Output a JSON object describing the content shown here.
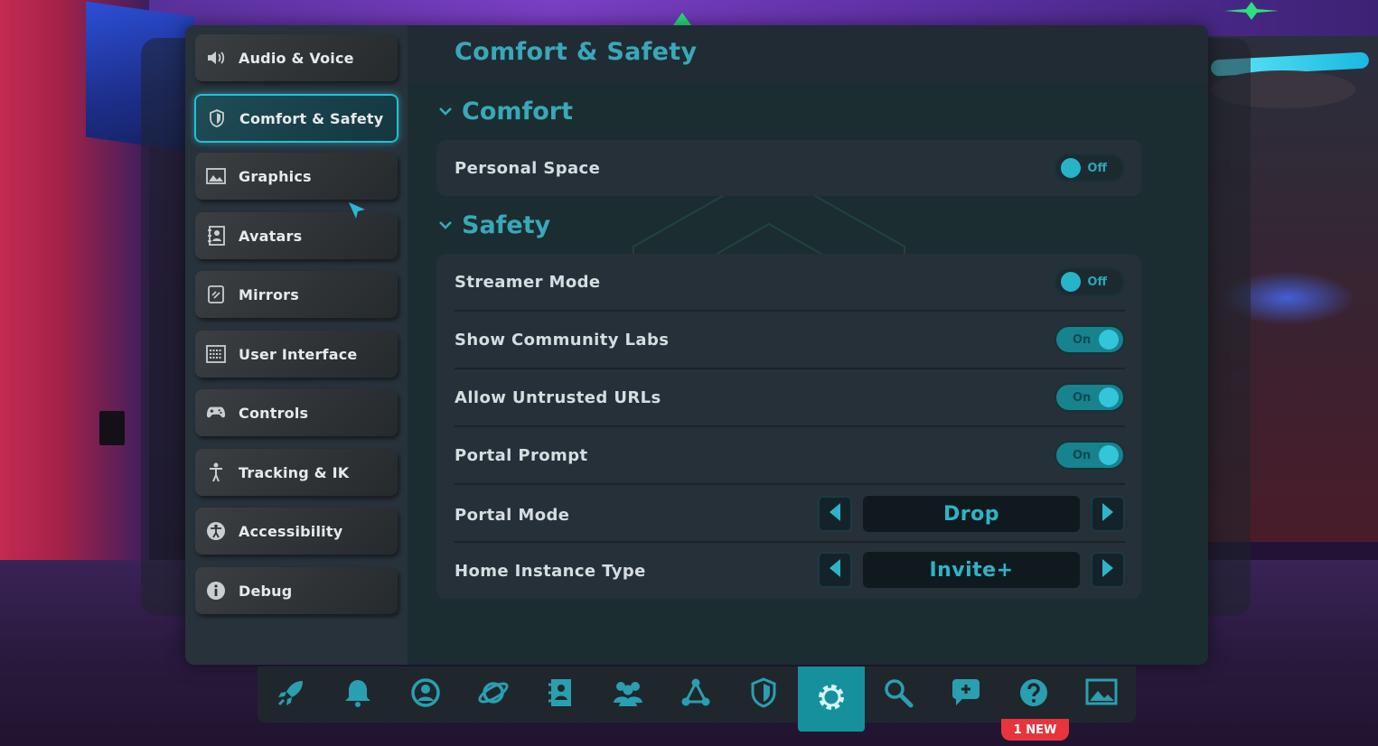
{
  "sidebar": {
    "items": [
      {
        "label": "Audio & Voice",
        "icon": "speaker-icon",
        "active": false
      },
      {
        "label": "Comfort & Safety",
        "icon": "shield-icon",
        "active": true
      },
      {
        "label": "Graphics",
        "icon": "image-icon",
        "active": false
      },
      {
        "label": "Avatars",
        "icon": "avatar-book-icon",
        "active": false
      },
      {
        "label": "Mirrors",
        "icon": "mirror-icon",
        "active": false
      },
      {
        "label": "User Interface",
        "icon": "keyboard-icon",
        "active": false
      },
      {
        "label": "Controls",
        "icon": "gamepad-icon",
        "active": false
      },
      {
        "label": "Tracking & IK",
        "icon": "person-icon",
        "active": false
      },
      {
        "label": "Accessibility",
        "icon": "accessibility-icon",
        "active": false
      },
      {
        "label": "Debug",
        "icon": "info-icon",
        "active": false
      }
    ]
  },
  "page": {
    "title": "Comfort & Safety"
  },
  "comfort": {
    "title": "Comfort",
    "personal_space": {
      "label": "Personal Space",
      "state": "Off"
    }
  },
  "safety": {
    "title": "Safety",
    "streamer_mode": {
      "label": "Streamer Mode",
      "state": "Off"
    },
    "community_labs": {
      "label": "Show Community Labs",
      "state": "On"
    },
    "untrusted_urls": {
      "label": "Allow Untrusted URLs",
      "state": "On"
    },
    "portal_prompt": {
      "label": "Portal Prompt",
      "state": "On"
    },
    "portal_mode": {
      "label": "Portal Mode",
      "value": "Drop"
    },
    "home_instance": {
      "label": "Home Instance Type",
      "value": "Invite+"
    }
  },
  "bottombar": {
    "items": [
      "rocket-icon",
      "bell-icon",
      "profile-icon",
      "planet-icon",
      "avatars-icon",
      "friends-icon",
      "network-icon",
      "shield-icon",
      "gear-icon",
      "search-icon",
      "chat-plus-icon",
      "help-icon",
      "gallery-icon"
    ],
    "active": "gear-icon",
    "badge": "1 NEW"
  },
  "colors": {
    "accent": "#39a8b8",
    "toggle_on": "#17838f",
    "badge": "#e8343c"
  }
}
